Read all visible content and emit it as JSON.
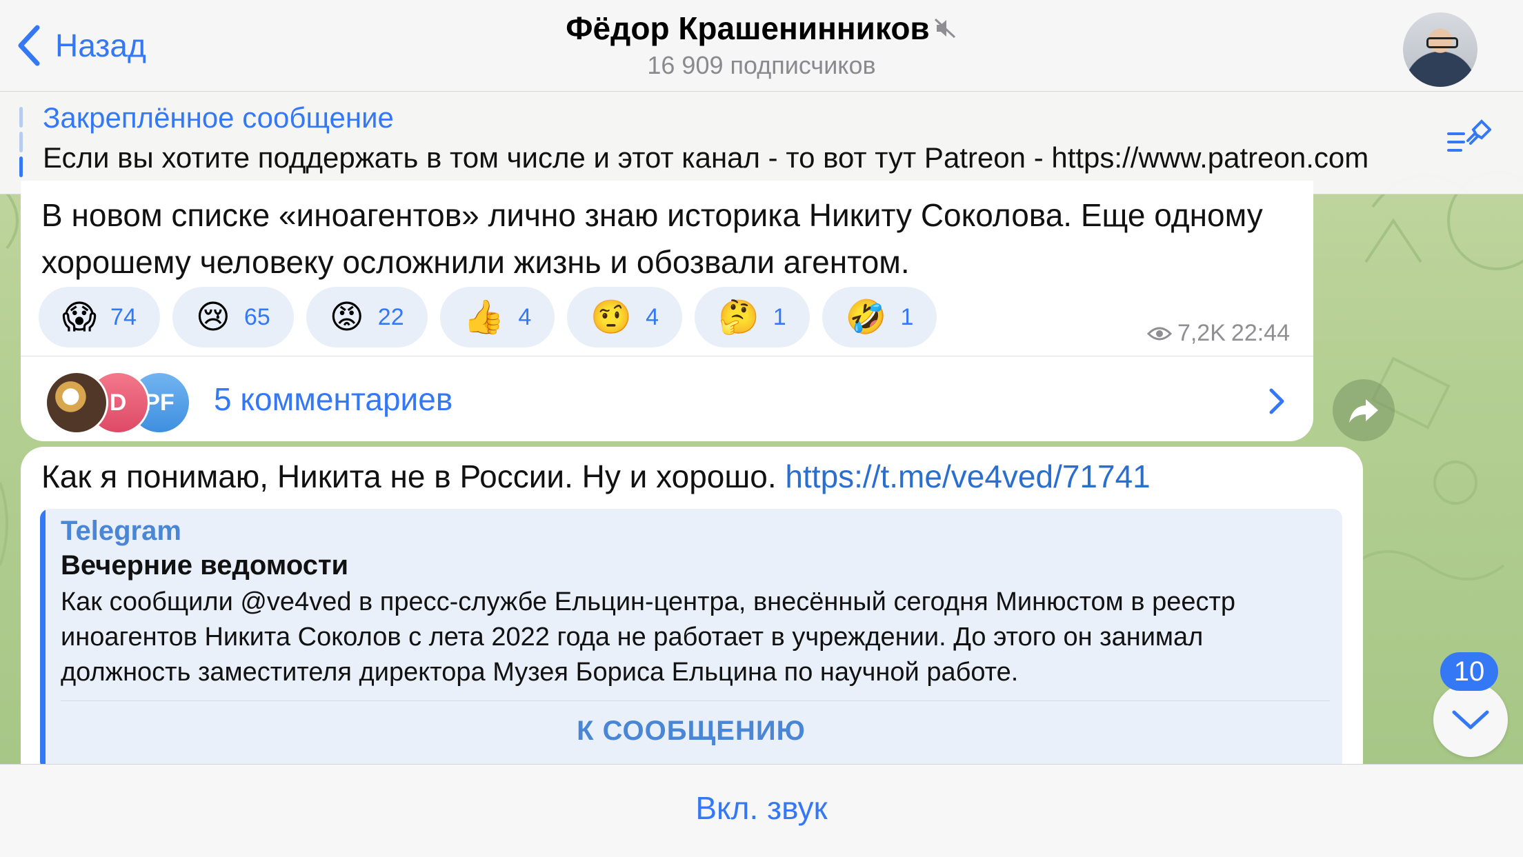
{
  "header": {
    "back_label": "Назад",
    "channel_name": "Фёдор Крашенинников",
    "subscribers": "16 909 подписчиков"
  },
  "pinned": {
    "title": "Закреплённое сообщение",
    "text": "Если вы хотите поддержать в том числе и этот канал - то вот тут Patreon - https://www.patreon.com"
  },
  "message1": {
    "text": "В новом списке «иноагентов» лично знаю историка Никиту Соколова. Еще одному хорошему человеку осложнили жизнь и обозвали агентом.",
    "reactions": [
      {
        "emoji": "😱",
        "count": "74"
      },
      {
        "emoji": "😢",
        "count": "65"
      },
      {
        "emoji": "😡",
        "count": "22"
      },
      {
        "emoji": "👍",
        "count": "4"
      },
      {
        "emoji": "🤨",
        "count": "4"
      },
      {
        "emoji": "🤔",
        "count": "1"
      },
      {
        "emoji": "🤣",
        "count": "1"
      }
    ],
    "views": "7,2K",
    "time": "22:44",
    "comment_avatars": [
      "",
      "D",
      "PF"
    ],
    "comments_label": "5 комментариев"
  },
  "message2": {
    "text": "Как я понимаю, Никита не в России. Ну и хорошо.",
    "link": "https://t.me/ve4ved/71741",
    "preview": {
      "site": "Telegram",
      "title": "Вечерние ведомости",
      "description": "Как сообщили @ve4ved в пресс-службе Ельцин-центра, внесённый сегодня Минюстом в реестр иноагентов Никита Соколов с лета 2022 года не работает в учреждении. До этого он занимал должность заместителя директора Музея Бориса Ельцина по научной работе.",
      "button": "К СООБЩЕНИЮ"
    }
  },
  "unread_badge": "10",
  "footer": {
    "unmute_label": "Вкл. звук"
  },
  "colors": {
    "accent": "#3478f6",
    "wallpaper": "#b4cf92",
    "reaction_bg": "#e8eff8"
  }
}
